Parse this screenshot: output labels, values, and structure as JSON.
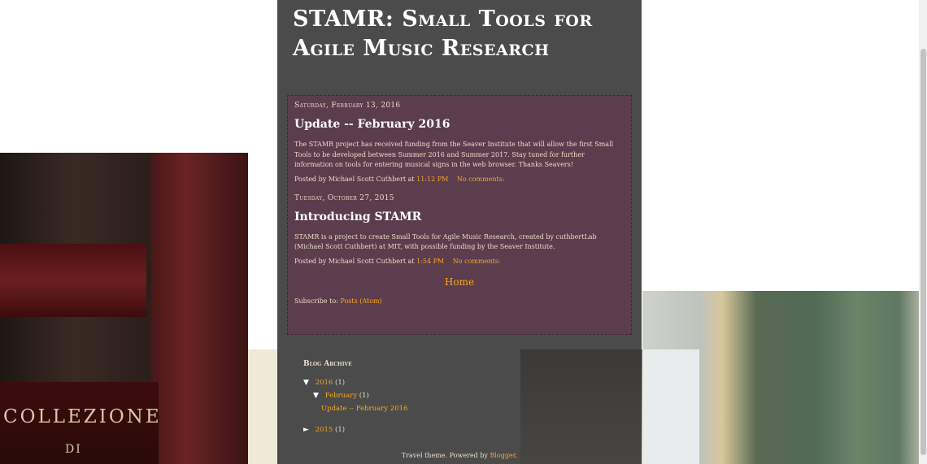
{
  "background": {
    "book_text_1": "COLLEZIONE",
    "book_text_2": "DI"
  },
  "header": {
    "title": "STAMR: Small Tools for Agile Music Research"
  },
  "posts": [
    {
      "date": "Saturday, February 13, 2016",
      "title": "Update -- February 2016",
      "body": "The STAMR project has received funding from the Seaver Institute that will allow the first Small Tools to be developed between Summer 2016 and Summer 2017.  Stay tuned for further information on tools for entering musical signs in the web browser.  Thanks Seavers!",
      "posted_by": "Posted by Michael Scott Cuthbert at",
      "time": "11:12 PM",
      "comments": "No comments:"
    },
    {
      "date": "Tuesday, October 27, 2015",
      "title": "Introducing STAMR",
      "body": "STAMR is a project to create Small Tools for Agile Music Research, created by cuthbertLab (Michael Scott Cuthbert) at MIT, with possible funding by the Seaver Institute.",
      "posted_by": "Posted by Michael Scott Cuthbert at",
      "time": "1:54 PM",
      "comments": "No comments:"
    }
  ],
  "home_link": "Home",
  "subscribe": {
    "label": "Subscribe to:",
    "link": "Posts (Atom)"
  },
  "archive": {
    "title": "Blog Archive",
    "year_2016": "2016",
    "year_2016_count": "(1)",
    "month_feb": "February",
    "month_feb_count": "(1)",
    "post_link": "Update -- February 2016",
    "year_2015": "2015",
    "year_2015_count": "(1)"
  },
  "attribution": {
    "text": "Travel theme. Powered by",
    "link": "Blogger",
    "end": "."
  },
  "colors": {
    "accent": "#f6a623",
    "column_bg": "#323232",
    "post_box_bg": "#623a4e"
  }
}
